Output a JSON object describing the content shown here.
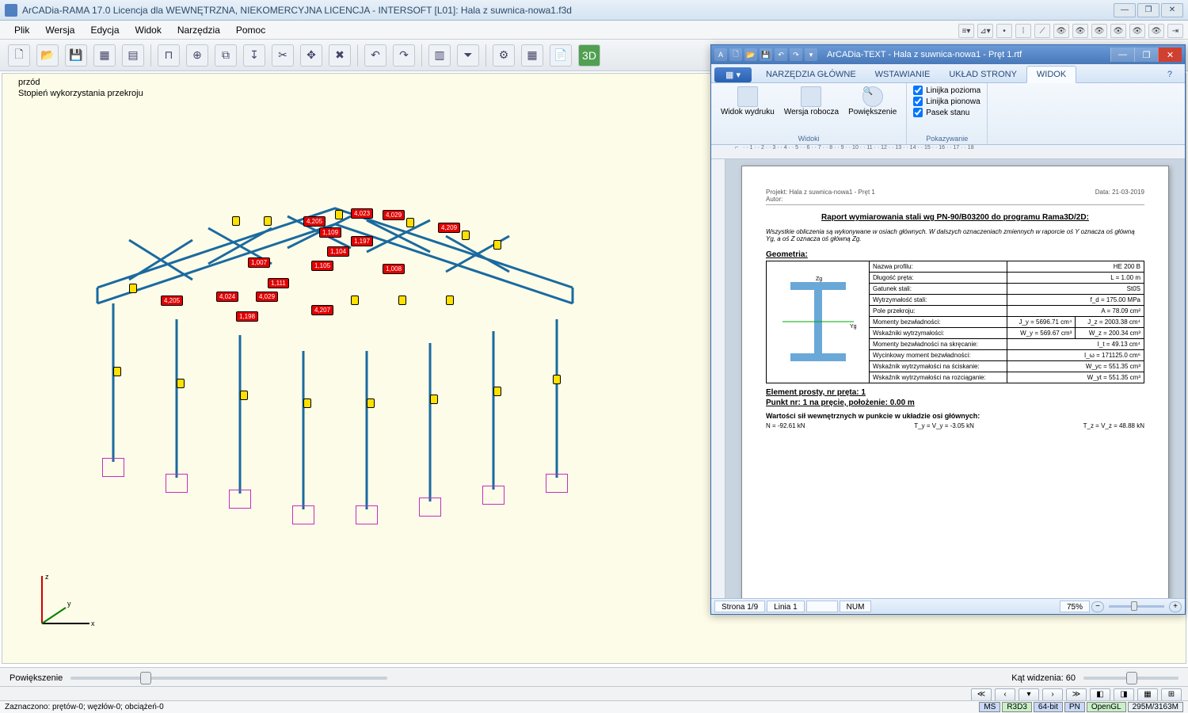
{
  "main": {
    "title": "ArCADia-RAMA 17.0 Licencja dla WEWNĘTRZNA, NIEKOMERCYJNA LICENCJA - INTERSOFT [L01]: Hala z suwnica-nowa1.f3d",
    "menu": [
      "Plik",
      "Wersja",
      "Edycja",
      "Widok",
      "Narzędzia",
      "Pomoc"
    ],
    "canvas": {
      "line1": "przód",
      "line2": "Stopień wykorzystania przekroju"
    },
    "zoom_label": "Powiększenie",
    "fov_label": "Kąt widzenia: 60",
    "status_left": "Zaznaczono: prętów-0; węzłów-0; obciążeń-0",
    "badges": [
      "MS",
      "R3D3",
      "64-bit",
      "PN",
      "OpenGL",
      "295M/3163M"
    ],
    "tags": [
      "4,205",
      "1,109",
      "4,023",
      "4,029",
      "4,209",
      "1,197",
      "1,104",
      "1,007",
      "1,105",
      "1,008",
      "4,205",
      "4,024",
      "4,029",
      "1,111",
      "1,198",
      "4,207"
    ]
  },
  "doc": {
    "title": "ArCADia-TEXT - Hala z suwnica-nowa1 - Pręt 1.rtf",
    "tabs": {
      "file": "",
      "main": "NARZĘDZIA GŁÓWNE",
      "insert": "WSTAWIANIE",
      "layout": "UKŁAD STRONY",
      "view": "WIDOK"
    },
    "ribbon": {
      "views_group": "Widoki",
      "show_group": "Pokazywanie",
      "btn_print": "Widok wydruku",
      "btn_draft": "Wersja robocza",
      "btn_zoom": "Powiększenie",
      "chk_hruler": "Linijka pozioma",
      "chk_vruler": "Linijka pionowa",
      "chk_status": "Pasek stanu"
    },
    "status": {
      "page": "Strona 1/9",
      "line": "Linia 1",
      "num": "NUM",
      "zoom": "75%"
    },
    "page": {
      "hdr_project": "Projekt: Hala z suwnica-nowa1 - Pręt 1",
      "hdr_author": "Autor:",
      "hdr_date": "Data: 21-03-2019",
      "title": "Raport wymiarowania stali wg PN-90/B03200 do programu Rama3D/2D:",
      "note": "Wszystkie obliczenia są wykonywane w osiach głównych. W dalszych oznaczeniach zmiennych w raporcie oś Y oznacza oś główną Yg, a oś Z oznacza oś główną Zg.",
      "geom_hdr": "Geometria:",
      "rows": {
        "profile": {
          "l": "Nazwa profilu:",
          "r": "HE 200 B"
        },
        "length": {
          "l": "Długość pręta:",
          "r": "L = 1.00 m"
        },
        "grade": {
          "l": "Gatunek stali:",
          "r": "St0S"
        },
        "strength": {
          "l": "Wytrzymałość stali:",
          "r": "f_d = 175.00 MPa"
        },
        "area": {
          "l": "Pole przekroju:",
          "r": "A = 78.09 cm²"
        },
        "inertia": {
          "l": "Momenty bezwładności:",
          "r1": "J_y = 5696.71 cm⁴",
          "r2": "J_z = 2003.38 cm⁴"
        },
        "section": {
          "l": "Wskaźniki wytrzymałości:",
          "r1": "W_y = 569.67 cm³",
          "r2": "W_z = 200.34 cm³"
        },
        "torsion": {
          "l": "Momenty bezwładności na skręcanie:",
          "r": "I_t = 49.13 cm⁴"
        },
        "warp": {
          "l": "Wycinkowy moment bezwładności:",
          "r": "I_ω = 171125.0 cm⁶"
        },
        "wyc": {
          "l": "Wskaźnik wytrzymałości na ściskanie:",
          "r": "W_yc = 551.35 cm³"
        },
        "wyt": {
          "l": "Wskaźnik wytrzymałości na rozciąganie:",
          "r": "W_yt = 551.35 cm³"
        }
      },
      "elem": "Element prosty, nr pręta: 1",
      "point": "Punkt nr: 1 na pręcie, położenie: 0.00 m",
      "forces_hdr": "Wartości sił wewnętrznych w punkcie w układzie osi głównych:",
      "forces": {
        "n": "N = -92.61 kN",
        "ty": "T_y = V_y = -3.05 kN",
        "tz": "T_z = V_z = 48.88 kN"
      }
    }
  }
}
